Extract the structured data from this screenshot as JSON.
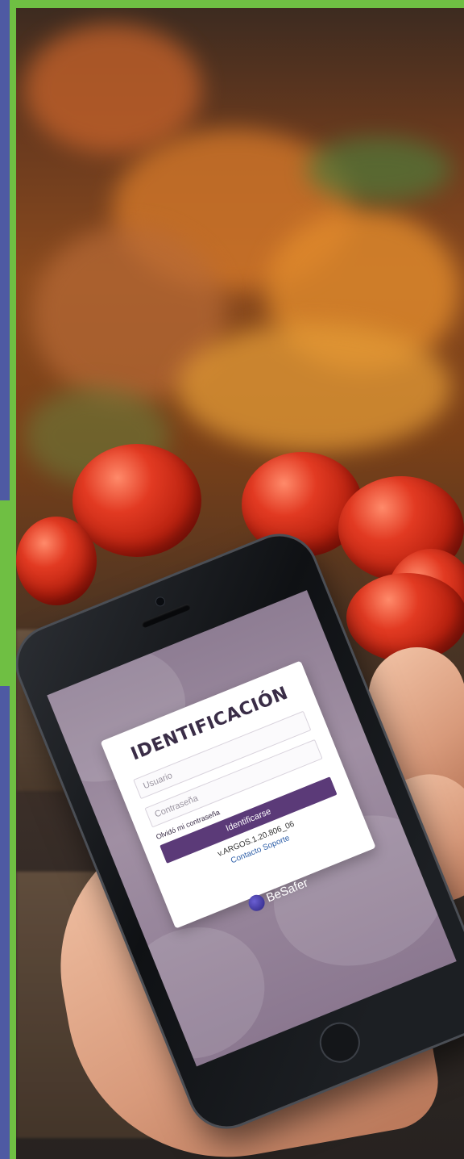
{
  "colors": {
    "frame_green": "#6fbf43",
    "frame_purple": "#4e5aa3",
    "button_purple": "#5b3a78",
    "link_blue": "#2e5fa8"
  },
  "login": {
    "title": "IDENTIFICACIÓN",
    "username_placeholder": "Usuario",
    "password_placeholder": "Contraseña",
    "forgot_password": "Olvidó mi contraseña",
    "submit_label": "Identificarse",
    "version": "v.ARGOS.1.20.806_06",
    "support_link": "Contacto Soporte"
  },
  "brand": {
    "name": "BeSafer",
    "logo_icon": "globe-icon"
  }
}
